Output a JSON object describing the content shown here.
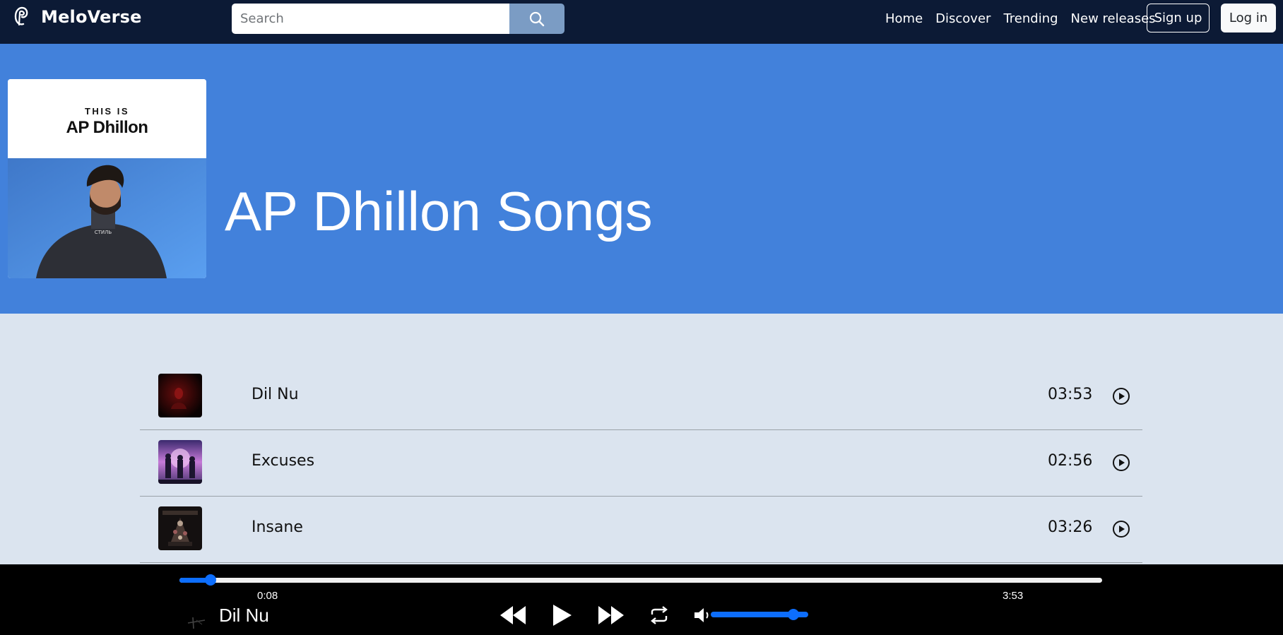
{
  "app": {
    "name": "MeloVerse"
  },
  "search": {
    "placeholder": "Search"
  },
  "nav": {
    "links": [
      "Home",
      "Discover",
      "Trending",
      "New releases"
    ],
    "signup_label": "Sign up",
    "login_label": "Log in"
  },
  "hero": {
    "cover_kicker": "THIS IS",
    "cover_artist": "AP Dhillon",
    "title": "AP Dhillon Songs"
  },
  "songs": [
    {
      "title": "Dil Nu",
      "duration": "03:53",
      "thumb_icon": "dil-nu-cover"
    },
    {
      "title": "Excuses",
      "duration": "02:56",
      "thumb_icon": "excuses-cover"
    },
    {
      "title": "Insane",
      "duration": "03:26",
      "thumb_icon": "insane-cover"
    }
  ],
  "player": {
    "current_time": "0:08",
    "total_time": "3:53",
    "now_playing": "Dil Nu",
    "progress_fraction": 0.034,
    "volume_fraction": 0.85
  },
  "colors": {
    "navbar": "#0c1a35",
    "hero": "#4281db",
    "page_bg": "#dbe4ef",
    "accent": "#0d6efd",
    "search_button": "#7b9cc4"
  }
}
